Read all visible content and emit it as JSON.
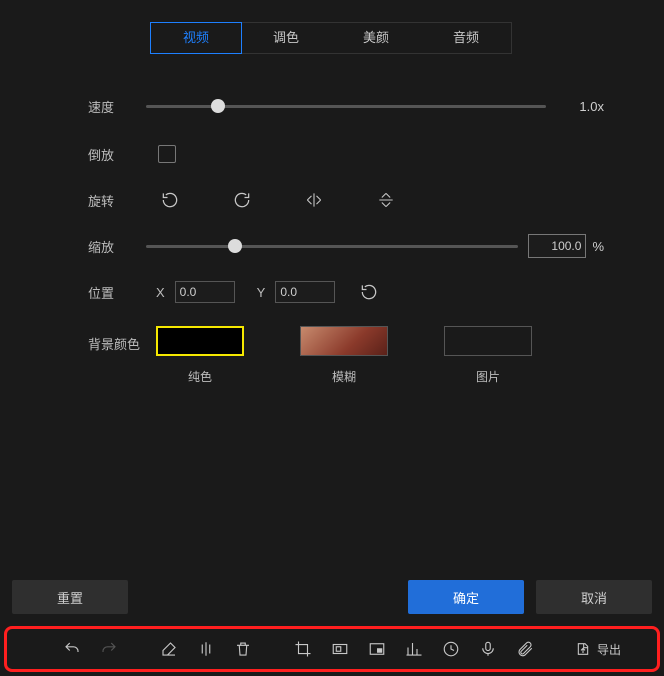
{
  "tabs": {
    "video": "视频",
    "color": "调色",
    "beauty": "美颜",
    "audio": "音频"
  },
  "labels": {
    "speed": "速度",
    "reverse": "倒放",
    "rotate": "旋转",
    "scale": "缩放",
    "position": "位置",
    "bgcolor": "背景颜色"
  },
  "speed": {
    "value": "1.0x"
  },
  "scale": {
    "value": "100.0",
    "unit": "%"
  },
  "position": {
    "xLabel": "X",
    "yLabel": "Y",
    "x": "0.0",
    "y": "0.0"
  },
  "bg": {
    "solid": "纯色",
    "blur": "模糊",
    "image": "图片"
  },
  "buttons": {
    "reset": "重置",
    "ok": "确定",
    "cancel": "取消",
    "export": "导出"
  }
}
